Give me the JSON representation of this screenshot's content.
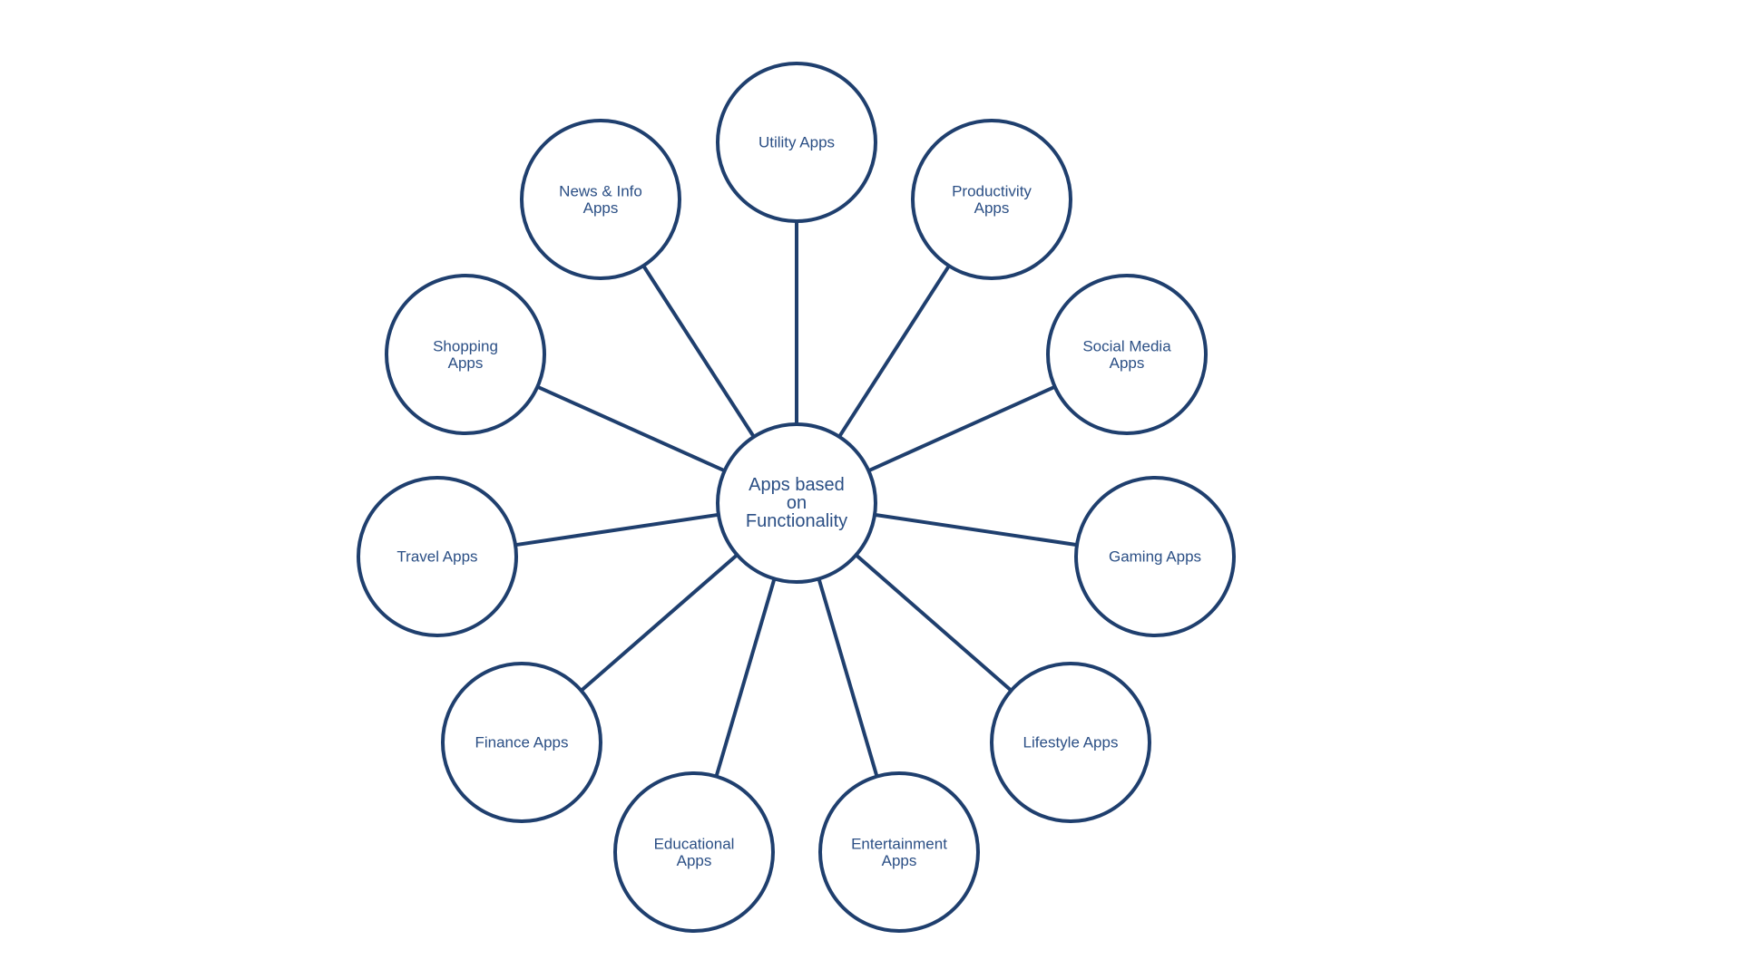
{
  "diagram": {
    "type": "hub-and-spoke",
    "line_color": "#1f3f6e",
    "text_color": "#2b4f85",
    "center": {
      "id": "center",
      "label_lines": [
        "Apps based",
        "on",
        "Functionality"
      ]
    },
    "nodes": [
      {
        "id": "utility",
        "label_lines": [
          "Utility Apps"
        ]
      },
      {
        "id": "productivity",
        "label_lines": [
          "Productivity",
          "Apps"
        ]
      },
      {
        "id": "social-media",
        "label_lines": [
          "Social Media",
          "Apps"
        ]
      },
      {
        "id": "gaming",
        "label_lines": [
          "Gaming Apps"
        ]
      },
      {
        "id": "lifestyle",
        "label_lines": [
          "Lifestyle Apps"
        ]
      },
      {
        "id": "entertainment",
        "label_lines": [
          "Entertainment",
          "Apps"
        ]
      },
      {
        "id": "educational",
        "label_lines": [
          "Educational",
          "Apps"
        ]
      },
      {
        "id": "finance",
        "label_lines": [
          "Finance Apps"
        ]
      },
      {
        "id": "travel",
        "label_lines": [
          "Travel Apps"
        ]
      },
      {
        "id": "shopping",
        "label_lines": [
          "Shopping",
          "Apps"
        ]
      },
      {
        "id": "news-info",
        "label_lines": [
          "News & Info",
          "Apps"
        ]
      }
    ],
    "edges": [
      [
        "center",
        "utility"
      ],
      [
        "center",
        "productivity"
      ],
      [
        "center",
        "social-media"
      ],
      [
        "center",
        "gaming"
      ],
      [
        "center",
        "lifestyle"
      ],
      [
        "center",
        "entertainment"
      ],
      [
        "center",
        "educational"
      ],
      [
        "center",
        "finance"
      ],
      [
        "center",
        "travel"
      ],
      [
        "center",
        "shopping"
      ],
      [
        "center",
        "news-info"
      ]
    ]
  }
}
